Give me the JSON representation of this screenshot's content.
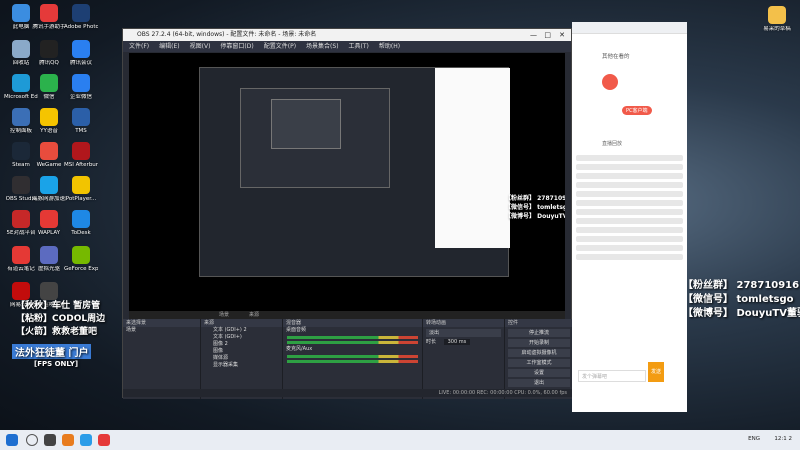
{
  "desktop_icons": [
    {
      "label": "此电脑",
      "color": "#3b8de0"
    },
    {
      "label": "腾讯手游助手",
      "color": "#e53a3a"
    },
    {
      "label": "Adobe Photosh...",
      "color": "#1d3f73"
    },
    {
      "label": "回收站",
      "color": "#8aa9c9"
    },
    {
      "label": "腾讯QQ",
      "color": "#222"
    },
    {
      "label": "腾讯会议",
      "color": "#2a7ff0"
    },
    {
      "label": "Microsoft Edge",
      "color": "#1e9ad6"
    },
    {
      "label": "微信",
      "color": "#2bb24c"
    },
    {
      "label": "企业微信",
      "color": "#2a7ff0"
    },
    {
      "label": "控制面板",
      "color": "#3b6fb6"
    },
    {
      "label": "YY语音",
      "color": "#f5c400"
    },
    {
      "label": "TMS",
      "color": "#2b5fa8"
    },
    {
      "label": "Steam",
      "color": "#1b2838"
    },
    {
      "label": "WeGame",
      "color": "#e84c3d"
    },
    {
      "label": "MSI Afterburner",
      "color": "#b1171c"
    },
    {
      "label": "OBS Studio",
      "color": "#302e31"
    },
    {
      "label": "海豚网游加速器5.0",
      "color": "#1aa3e8"
    },
    {
      "label": "PotPlayer...",
      "color": "#f2c400"
    },
    {
      "label": "5E对战平台",
      "color": "#c62828"
    },
    {
      "label": "WAPLAY",
      "color": "#e53935"
    },
    {
      "label": "ToDesk",
      "color": "#1e88e5"
    },
    {
      "label": "有道云笔记",
      "color": "#e53935"
    },
    {
      "label": "虚拟光驱",
      "color": "#5c6bc0"
    },
    {
      "label": "GeForce Experience",
      "color": "#76b900"
    },
    {
      "label": "网易云音",
      "color": "#c20c0c"
    },
    {
      "label": "使命召唤手游",
      "color": "#444"
    }
  ],
  "right_desktop_icon": {
    "label": "易采的草稿"
  },
  "obs": {
    "title": "OBS 27.2.4 (64-bit, windows) - 配置文件: 未命名 - 场景: 未命名",
    "menu": [
      "文件(F)",
      "编辑(E)",
      "视图(V)",
      "停靠窗口(D)",
      "配置文件(P)",
      "场景集合(S)",
      "工具(T)",
      "帮助(H)"
    ],
    "scene_bar": [
      "场景",
      "来源"
    ],
    "docks": {
      "scenes_title": "来选择景",
      "scenes": [
        "场景"
      ],
      "sources_title": "来源",
      "sources": [
        "文本 (GDI+) 2",
        "文本 (GDI+)",
        "图像 2",
        "图像",
        "媒体源",
        "显示器采集"
      ],
      "mixer_title": "混音器",
      "mixer": [
        {
          "name": "桌面音频",
          "db": "0.0 dB"
        },
        {
          "name": "麦克风/Aux",
          "db": "0.0 dB"
        }
      ],
      "transition_title": "转场动画",
      "transition": {
        "type": "淡出",
        "duration_label": "时长",
        "duration": "300 ms"
      },
      "controls_title": "控件",
      "controls": [
        "停止推流",
        "开始录制",
        "启动虚拟摄像机",
        "工作室模式",
        "设置",
        "退出"
      ]
    },
    "status": "LIVE: 00:00:00   REC: 00:00:00   CPU: 0.0%, 60.00 fps"
  },
  "overlay": {
    "line1": "【粉丝群】 278710916",
    "line2": "【微信号】 tomletsgo",
    "line3": "【微博号】 DouyuTV董驴",
    "left1": "【秋秋】车仕 暂房管",
    "left2": "【粘粉】CODOL周边",
    "left3": "【火箭】救救老董吧",
    "tag": "法外狂徒董 门户",
    "fps": "[FPS ONLY]"
  },
  "browser": {
    "tab": "其他在看的",
    "pc_label": "PC客户端",
    "section": "直播回放",
    "search_hint": "发个弹幕吧",
    "send": "发送"
  },
  "taskbar": {
    "lang": "ENG",
    "time": "12:1 2",
    "colors": [
      "#1f6fd0",
      "#444",
      "#e87c1e",
      "#2b9de8",
      "#e53a3a"
    ]
  }
}
